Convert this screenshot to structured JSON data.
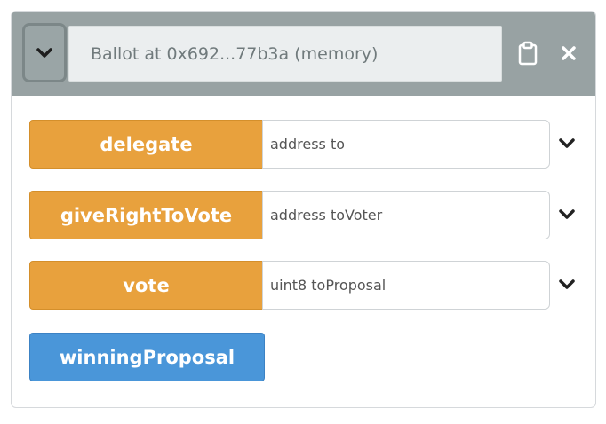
{
  "instance": {
    "title": "Ballot at 0x692...77b3a (memory)",
    "collapse_icon": "chevron-down-icon",
    "copy_icon": "clipboard-icon",
    "close_icon": "close-icon"
  },
  "functions": [
    {
      "label": "delegate",
      "placeholder": "address to",
      "value": ""
    },
    {
      "label": "giveRightToVote",
      "placeholder": "address toVoter",
      "value": ""
    },
    {
      "label": "vote",
      "placeholder": "uint8 toProposal",
      "value": ""
    }
  ],
  "calls": [
    {
      "label": "winningProposal"
    }
  ],
  "colors": {
    "header_bg": "#98a2a3",
    "transact_button": "#e8a13d",
    "call_button": "#4a96d9",
    "icon_dark": "#222222"
  }
}
